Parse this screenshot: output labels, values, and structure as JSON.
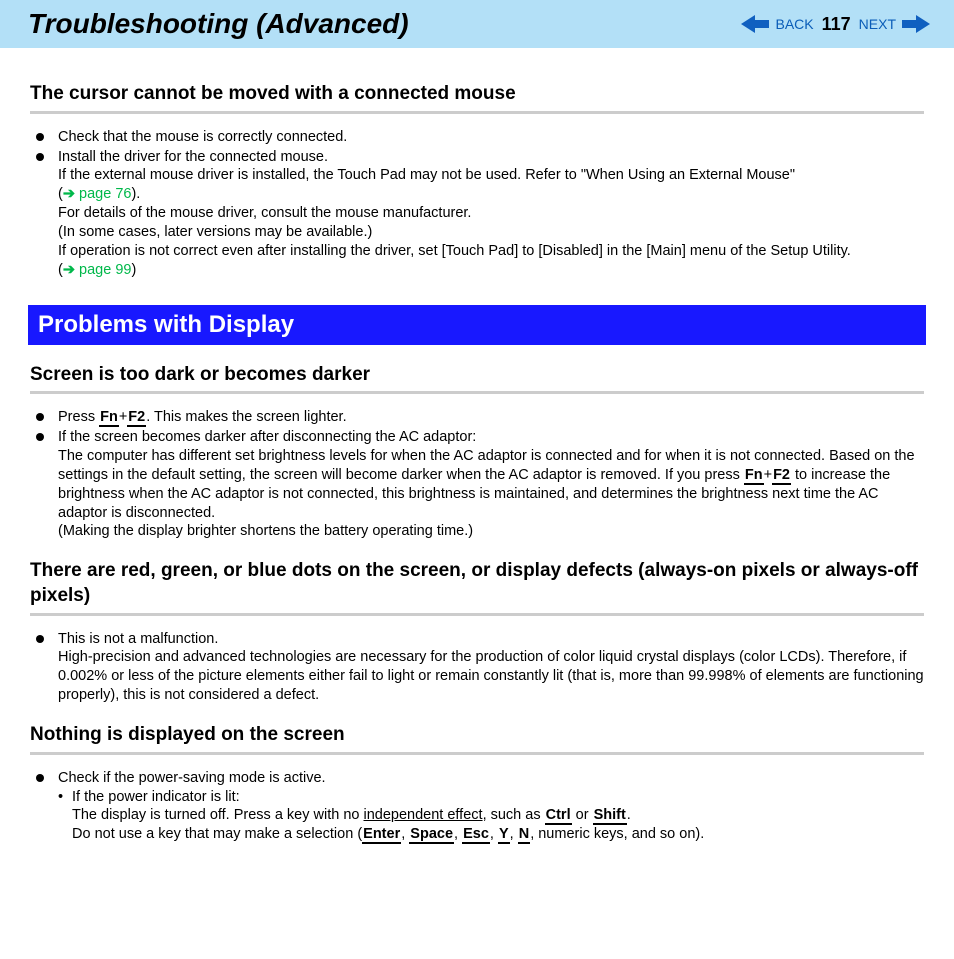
{
  "header": {
    "title": "Troubleshooting (Advanced)",
    "back_label": "BACK",
    "next_label": "NEXT",
    "page_number": "117"
  },
  "section1": {
    "heading": "The cursor cannot be moved with a connected mouse",
    "b1": "Check that the mouse is correctly connected.",
    "b2": "Install the driver for the connected mouse.",
    "b2_line1": "If the external mouse driver is installed, the Touch Pad may not be used. Refer to \"When Using an External Mouse\"",
    "b2_link1_pre": "(",
    "b2_link1": "page 76",
    "b2_link1_post": ").",
    "b2_line2": "For details of the mouse driver, consult the mouse manufacturer.",
    "b2_line3": "(In some cases, later versions may be available.)",
    "b2_line4": "If operation is not correct even after installing the driver, set [Touch Pad] to [Disabled] in the [Main] menu of the Setup Utility.",
    "b2_link2_pre": "(",
    "b2_link2": "page 99",
    "b2_link2_post": ")"
  },
  "blue_heading": "Problems with Display",
  "section2": {
    "heading": "Screen is too dark or becomes darker",
    "b1_pre": "Press ",
    "key_fn": "Fn",
    "plus": "+",
    "key_f2": "F2",
    "b1_post": ". This makes the screen lighter.",
    "b2": "If the screen becomes darker after disconnecting the AC adaptor:",
    "b2_line1_a": "The computer has different set brightness levels for when the AC adaptor is connected and for when it is not connected. Based on the settings in the default setting, the screen will become darker when the AC adaptor is removed. If you press ",
    "b2_line1_b": " to increase the brightness when the AC adaptor is not connected, this brightness is maintained, and determines the brightness next time the AC adaptor is disconnected.",
    "b2_line2": "(Making the display brighter shortens the battery operating time.)"
  },
  "section3": {
    "heading": "There are red, green, or blue dots on the screen, or display defects (always-on pixels or always-off pixels)",
    "b1": "This is not a malfunction.",
    "b1_line1": "High-precision and advanced technologies are necessary for the production of color liquid crystal displays (color LCDs). Therefore, if 0.002% or less of the picture elements either fail to light or remain constantly lit (that is, more than 99.998% of elements are functioning properly), this is not considered a defect."
  },
  "section4": {
    "heading": "Nothing is displayed on the screen",
    "b1": "Check if the power-saving mode is active.",
    "d1": "If the power indicator is lit:",
    "d1_line1_a": "The display is turned off. Press a key with no ",
    "underline1": "independent effect",
    "d1_line1_b": ", such as ",
    "key_ctrl": "Ctrl",
    "or": " or ",
    "key_shift": "Shift",
    "period": ".",
    "d1_line2_a": "Do not use a key that may make a selection (",
    "key_enter": "Enter",
    "comma": ", ",
    "key_space": "Space",
    "key_esc": "Esc",
    "key_y": "Y",
    "key_n": "N",
    "d1_line2_b": ", numeric keys, and so on)."
  }
}
